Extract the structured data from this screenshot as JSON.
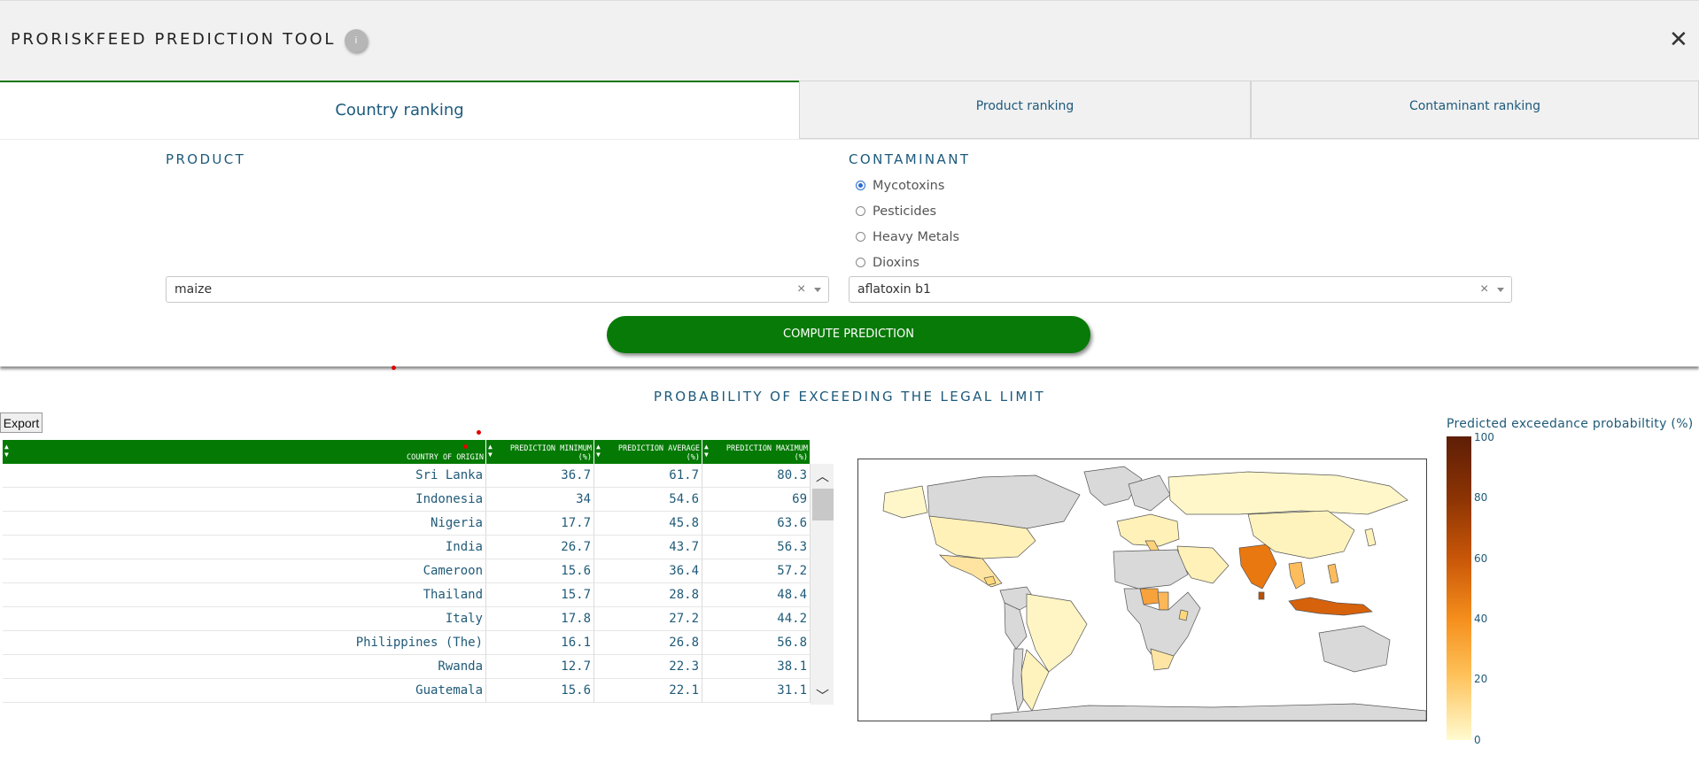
{
  "header": {
    "title": "PRORISKFEED PREDICTION TOOL",
    "info_label": "i",
    "close_glyph": "✕"
  },
  "tabs": [
    {
      "label": "Country ranking",
      "active": true
    },
    {
      "label": "Product ranking",
      "active": false
    },
    {
      "label": "Contaminant ranking",
      "active": false
    }
  ],
  "product": {
    "label": "PRODUCT",
    "value": "maize"
  },
  "contaminant": {
    "label": "CONTAMINANT",
    "options": [
      "Mycotoxins",
      "Pesticides",
      "Heavy Metals",
      "Dioxins"
    ],
    "selected_option": "Mycotoxins",
    "value": "aflatoxin b1"
  },
  "compute_label": "COMPUTE PREDICTION",
  "results": {
    "title": "PROBABILITY OF EXCEEDING THE LEGAL LIMIT",
    "export_label": "Export",
    "columns": [
      "COUNTRY OF ORIGIN",
      "PREDICTION MINIMUM (%)",
      "PREDICTION AVERAGE (%)",
      "PREDICTION MAXIMUM (%)"
    ],
    "rows": [
      {
        "country": "Sri Lanka",
        "min": "36.7",
        "avg": "61.7",
        "max": "80.3"
      },
      {
        "country": "Indonesia",
        "min": "34",
        "avg": "54.6",
        "max": "69"
      },
      {
        "country": "Nigeria",
        "min": "17.7",
        "avg": "45.8",
        "max": "63.6"
      },
      {
        "country": "India",
        "min": "26.7",
        "avg": "43.7",
        "max": "56.3"
      },
      {
        "country": "Cameroon",
        "min": "15.6",
        "avg": "36.4",
        "max": "57.2"
      },
      {
        "country": "Thailand",
        "min": "15.7",
        "avg": "28.8",
        "max": "48.4"
      },
      {
        "country": "Italy",
        "min": "17.8",
        "avg": "27.2",
        "max": "44.2"
      },
      {
        "country": "Philippines (The)",
        "min": "16.1",
        "avg": "26.8",
        "max": "56.8"
      },
      {
        "country": "Rwanda",
        "min": "12.7",
        "avg": "22.3",
        "max": "38.1"
      },
      {
        "country": "Guatemala",
        "min": "15.6",
        "avg": "22.1",
        "max": "31.1"
      }
    ]
  },
  "map": {
    "colorbar_title": "Predicted exceedance probabiltity (%)",
    "ticks": [
      "100",
      "80",
      "60",
      "40",
      "20",
      "0"
    ],
    "no_data_color": "#d9d9d9",
    "scale_colors": [
      "#fffbd0",
      "#fec057",
      "#f58e1c",
      "#c85608",
      "#8b3304",
      "#5e1e06"
    ]
  }
}
